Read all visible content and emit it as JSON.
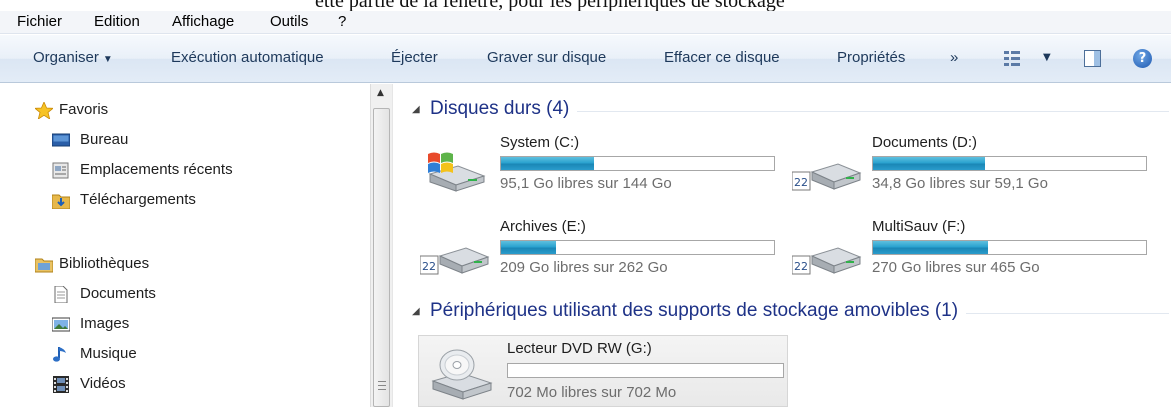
{
  "top_strip_text": "ette partie de la fenêtre, pour les périphériques de stockage",
  "menu": [
    "Fichier",
    "Edition",
    "Affichage",
    "Outils",
    "?"
  ],
  "toolbar": {
    "organise": "Organiser",
    "autoplay": "Exécution automatique",
    "eject": "Éjecter",
    "burn": "Graver sur disque",
    "erase": "Effacer ce disque",
    "properties": "Propriétés",
    "more": "»",
    "icons": [
      "view-options-icon",
      "preview-pane-icon",
      "help-icon"
    ]
  },
  "nav": {
    "favorites": {
      "label": "Favoris",
      "items": [
        {
          "label": "Bureau",
          "icon": "desktop-icon"
        },
        {
          "label": "Emplacements récents",
          "icon": "recent-places-icon"
        },
        {
          "label": "Téléchargements",
          "icon": "downloads-icon"
        }
      ]
    },
    "libraries": {
      "label": "Bibliothèques",
      "items": [
        {
          "label": "Documents",
          "icon": "documents-icon"
        },
        {
          "label": "Images",
          "icon": "pictures-icon"
        },
        {
          "label": "Musique",
          "icon": "music-icon"
        },
        {
          "label": "Vidéos",
          "icon": "videos-icon"
        }
      ]
    }
  },
  "groups": {
    "hard_disks": {
      "title": "Disques durs (4)",
      "drives": [
        {
          "name": "System (C:)",
          "free": "95,1 Go libres sur 144 Go",
          "used_fraction": 0.34,
          "icon": "windows-drive-icon"
        },
        {
          "name": "Documents (D:)",
          "free": "34,8 Go libres sur 59,1 Go",
          "used_fraction": 0.41,
          "icon": "hard-drive-icon"
        },
        {
          "name": "Archives (E:)",
          "free": "209 Go libres sur 262 Go",
          "used_fraction": 0.2,
          "icon": "hard-drive-icon"
        },
        {
          "name": "MultiSauv (F:)",
          "free": "270 Go libres sur 465 Go",
          "used_fraction": 0.42,
          "icon": "hard-drive-icon"
        }
      ]
    },
    "removable": {
      "title": "Périphériques utilisant des supports de stockage amovibles (1)",
      "drives": [
        {
          "name": "Lecteur DVD RW (G:)",
          "free": "702 Mo libres sur 702 Mo",
          "used_fraction": 0,
          "icon": "dvd-drive-icon"
        }
      ]
    }
  },
  "colors": {
    "group_title": "#1e3287",
    "bar_fill": "#2aa2cf"
  }
}
